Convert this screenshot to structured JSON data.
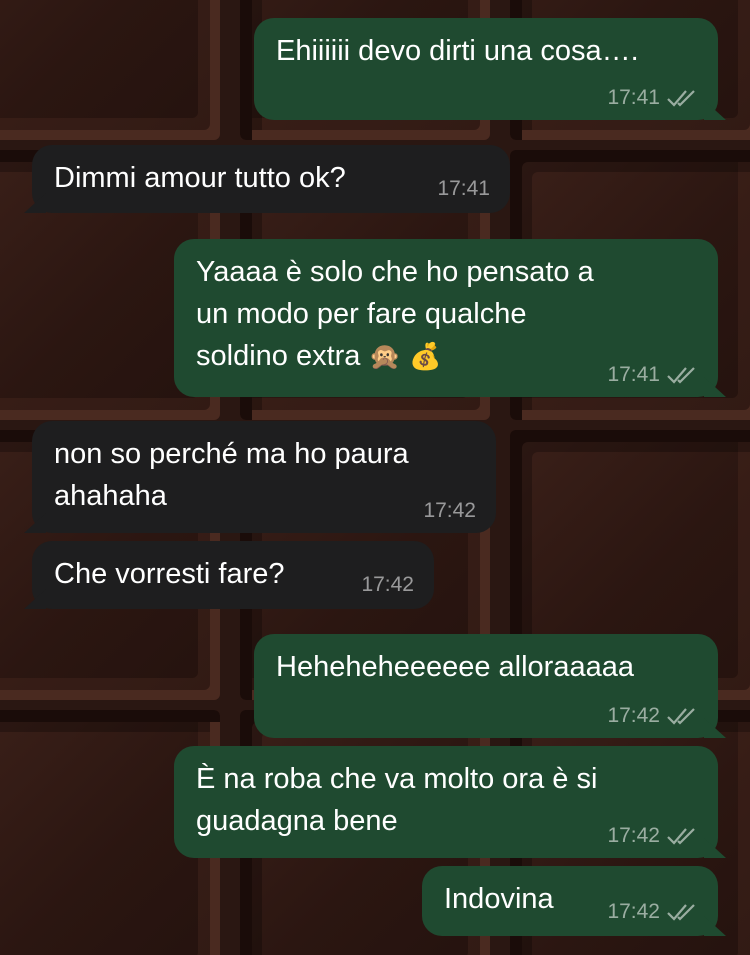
{
  "messages": [
    {
      "dir": "out",
      "text": "Ehiiiiii devo dirti una cosa….",
      "time": "17:41"
    },
    {
      "dir": "in",
      "text": "Dimmi amour tutto ok?",
      "time": "17:41"
    },
    {
      "dir": "out",
      "line1": "Yaaaa è solo che ho pensato a",
      "line2": "un modo per fare qualche",
      "line3": "soldino extra",
      "emoji1": "🙊",
      "emoji2": "💰",
      "time": "17:41"
    },
    {
      "dir": "in",
      "line1": "non so perché ma ho paura",
      "line2": "ahahaha",
      "time": "17:42"
    },
    {
      "dir": "in",
      "text": "Che vorresti fare?",
      "time": "17:42"
    },
    {
      "dir": "out",
      "text": "Heheheheeeeee alloraaaaa",
      "time": "17:42"
    },
    {
      "dir": "out",
      "line1": "È na roba che va molto ora è si",
      "line2": "guadagna bene",
      "time": "17:42"
    },
    {
      "dir": "out",
      "text": "Indovina",
      "time": "17:42"
    }
  ],
  "colors": {
    "outgoing_bubble": "#1f4a30",
    "incoming_bubble": "#1e1e1f",
    "wallpaper": "#2a1712"
  },
  "icons": {
    "read_receipt": "double-check-icon",
    "wallpaper": "chocolate-bar-pattern"
  }
}
